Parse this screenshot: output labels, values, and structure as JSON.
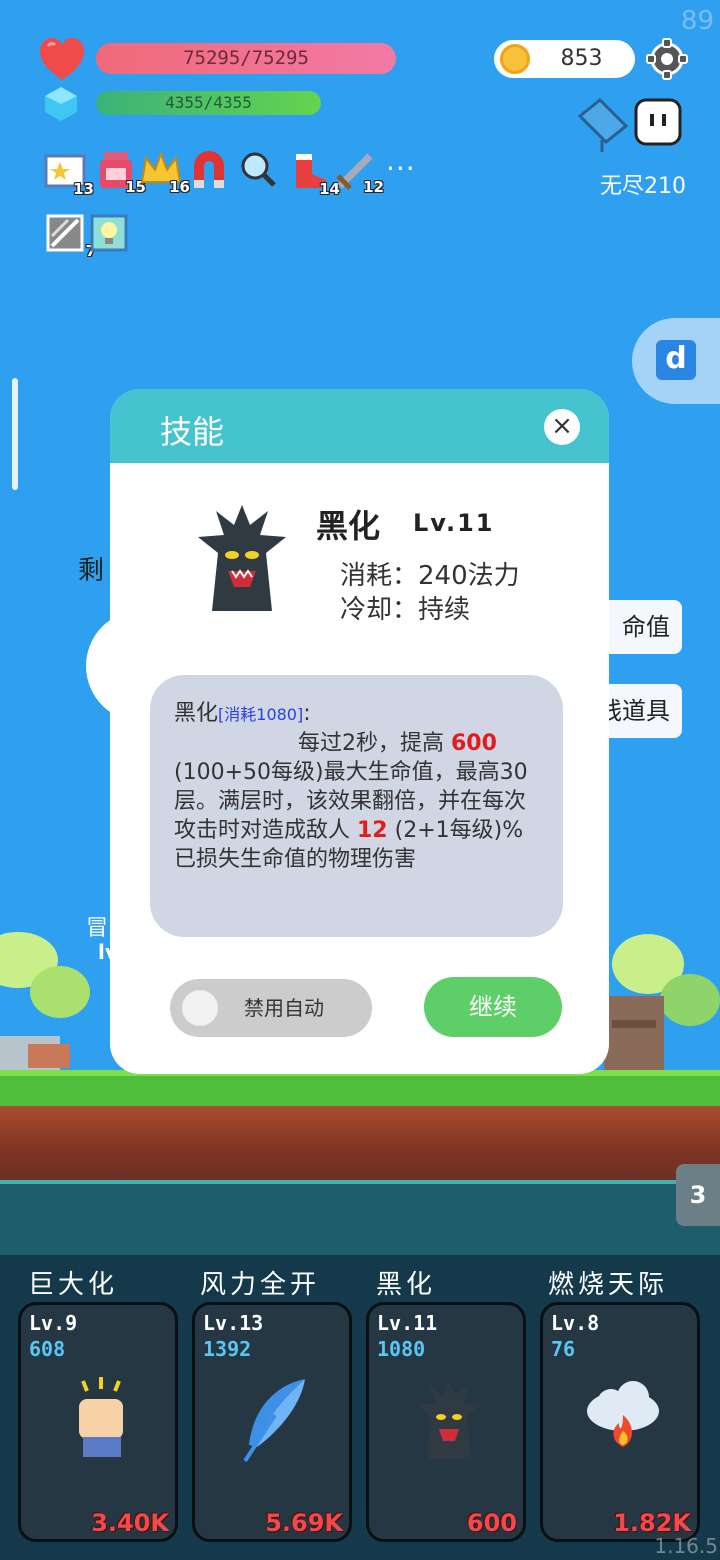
{
  "status": {
    "corner_number": "89",
    "version": "1.16.5"
  },
  "hud": {
    "hp": "75295/75295",
    "mp": "4355/4355",
    "gold": "853",
    "mode_label": "无尽210"
  },
  "items": [
    {
      "icon": "star-card-icon",
      "count": "13"
    },
    {
      "icon": "potion-jar-icon",
      "count": "15"
    },
    {
      "icon": "crown-icon",
      "count": "16"
    },
    {
      "icon": "magnet-icon",
      "count": ""
    },
    {
      "icon": "magnifier-icon",
      "count": ""
    },
    {
      "icon": "boot-icon",
      "count": "14"
    },
    {
      "icon": "sword-icon",
      "count": "12"
    },
    {
      "icon": "slash-card-icon",
      "count": "7"
    },
    {
      "icon": "lightbulb-icon",
      "count": ""
    }
  ],
  "more_items": "···",
  "background_peek": {
    "left_text": "剩",
    "btn1": "命值",
    "btn2": "线道具",
    "small1": "冒",
    "small2": "lv"
  },
  "modal": {
    "title": "技能",
    "close": "×",
    "skill_name": "黑化",
    "skill_level": "Lv.11",
    "cost_line": "消耗：240法力",
    "cooldown_line": "冷却：持续",
    "desc_name": "黑化",
    "desc_tag": "[消耗1080]",
    "desc_colon": ":",
    "desc_part1": "每过2秒，提高 ",
    "desc_val1": "600",
    "desc_part2": "(100+50每级)最大生命值，最高30层。满层时，该效果翻倍，并在每次攻击时对造成敌人 ",
    "desc_val2": "12",
    "desc_part3": "(2+1每级)%已损失生命值的物理伤害",
    "toggle_label": "禁用自动",
    "continue_label": "继续"
  },
  "right_tab": "3",
  "skills": [
    {
      "name": "巨大化",
      "level": "Lv.9",
      "cost": "608",
      "damage": "3.40K",
      "icon": "fist-icon"
    },
    {
      "name": "风力全开",
      "level": "Lv.13",
      "cost": "1392",
      "damage": "5.69K",
      "icon": "feather-icon"
    },
    {
      "name": "黑化",
      "level": "Lv.11",
      "cost": "1080",
      "damage": "600",
      "icon": "dark-tree-icon"
    },
    {
      "name": "燃烧天际",
      "level": "Lv.8",
      "cost": "76",
      "damage": "1.82K",
      "icon": "fire-cloud-icon"
    }
  ],
  "colors": {
    "sky": "#2f9ff0",
    "modal_header": "#45c3cf",
    "continue": "#5ecf68",
    "damage": "#f24a4a",
    "cost": "#59c6f3"
  }
}
